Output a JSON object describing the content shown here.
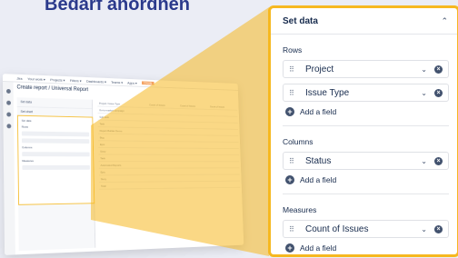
{
  "headline": "Bedarf anordnen",
  "app": {
    "brand": "Jira",
    "menu": [
      "Your work ▾",
      "Projects ▾",
      "Filters ▾",
      "Dashboards ▾",
      "Teams ▾",
      "Apps ▾"
    ],
    "create": "Create",
    "title": "Create report / Universal Report",
    "side_rows": [
      "Set data",
      "Set chart"
    ],
    "hl_labels": [
      "Set data",
      "Rows",
      "Columns",
      "Measures"
    ],
    "table_header": [
      "Project / Issue Type",
      "Count of Issues",
      "Count of Issues",
      "Count of Issues"
    ],
    "table_rows": [
      [
        "Go-to-market campaign",
        "",
        "",
        ""
      ],
      [
        "Sub-task",
        "",
        "",
        ""
      ],
      [
        "Task",
        "",
        "",
        ""
      ],
      [
        "Report Builder Demo",
        "",
        "",
        ""
      ],
      [
        "Bug",
        "",
        "",
        ""
      ],
      [
        "Epic",
        "",
        "",
        ""
      ],
      [
        "Story",
        "",
        "",
        ""
      ],
      [
        "Task",
        "",
        "",
        ""
      ],
      [
        "Automated Reports",
        "",
        "",
        ""
      ],
      [
        "Epic",
        "",
        "",
        ""
      ],
      [
        "Story",
        "",
        "",
        ""
      ],
      [
        "Total",
        "",
        "",
        ""
      ]
    ]
  },
  "panel": {
    "title": "Set data",
    "rows_label": "Rows",
    "rows": [
      "Project",
      "Issue Type"
    ],
    "columns_label": "Columns",
    "columns": [
      "Status"
    ],
    "measures_label": "Measures",
    "measures": [
      "Count of Issues"
    ],
    "add_label": "Add a field"
  },
  "colors": {
    "accent": "#f6b820",
    "headline": "#2b3a8c",
    "beam": "#f6b820"
  }
}
